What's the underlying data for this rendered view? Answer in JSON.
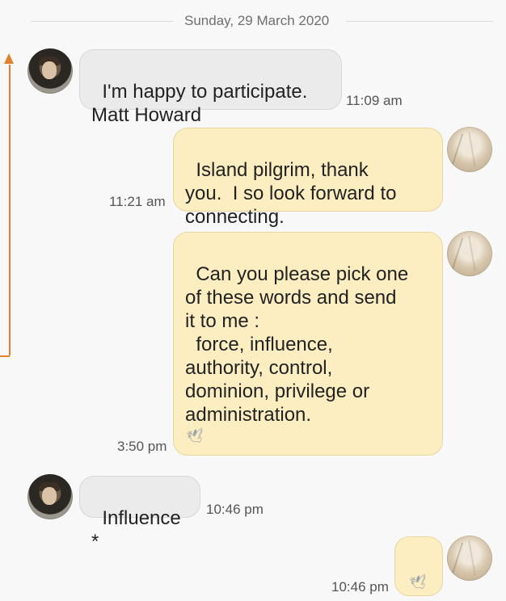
{
  "conversation": {
    "date": "Sunday, 29 March 2020",
    "messages": [
      {
        "sender": "them",
        "text": "I'm happy to participate.\nMatt Howard",
        "time": "11:09 am"
      },
      {
        "sender": "me",
        "text": "Island pilgrim, thank\nyou.  I so look forward to\nconnecting.",
        "time": "11:21 am",
        "icon": "dove-icon"
      },
      {
        "sender": "me",
        "text": "Can you please pick one\nof these words and send\nit to me :\n  force, influence,\nauthority, control,\ndominion, privilege or\nadministration.",
        "time": "3:50 pm",
        "icon": "dove-icon"
      },
      {
        "sender": "them",
        "text": "Influence *",
        "time": "10:46 pm"
      },
      {
        "sender": "me",
        "text": "",
        "time": "10:46 pm",
        "icon": "dove-icon"
      }
    ]
  },
  "colors": {
    "incoming_bubble": "#ebebeb",
    "outgoing_bubble": "#fdeec2",
    "annotation_arrow": "#e1802e"
  }
}
